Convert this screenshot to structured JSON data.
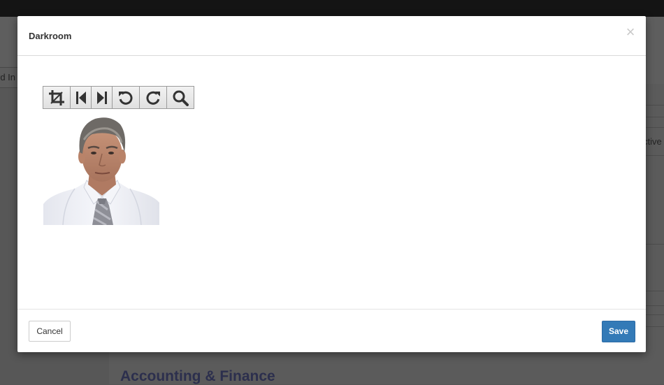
{
  "background": {
    "left_tab_label": "rd In",
    "right_tab_label": "ctive",
    "section_title": "Accounting & Finance"
  },
  "modal": {
    "title": "Darkroom",
    "close_glyph": "×",
    "toolbar": {
      "buttons": [
        {
          "icon": "crop-icon"
        },
        {
          "icon": "undo-history-icon"
        },
        {
          "icon": "redo-history-icon"
        },
        {
          "icon": "rotate-left-icon"
        },
        {
          "icon": "rotate-right-icon"
        },
        {
          "icon": "zoom-icon"
        }
      ]
    },
    "image": {
      "subject": "headshot-photo"
    },
    "footer": {
      "cancel_label": "Cancel",
      "save_label": "Save"
    }
  },
  "colors": {
    "save_button": "#337ab7",
    "top_bar": "#141414",
    "section_title": "#2c2f4d"
  }
}
